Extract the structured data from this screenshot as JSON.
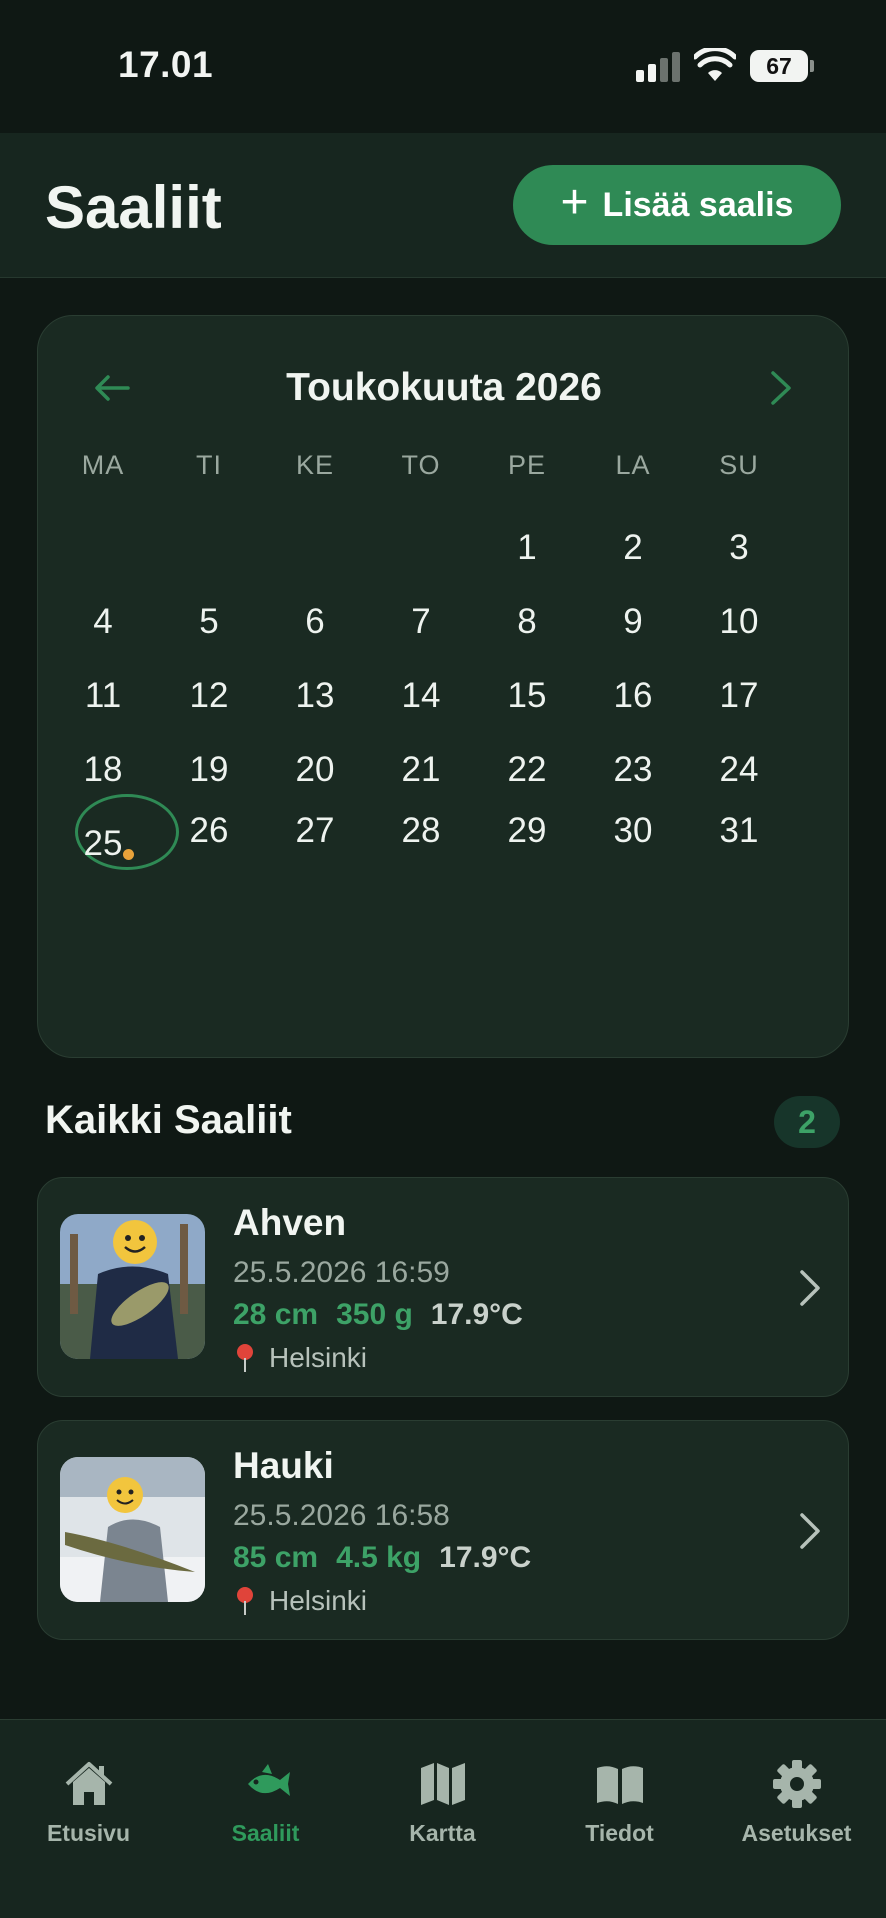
{
  "status": {
    "time": "17.01",
    "battery": "67"
  },
  "header": {
    "title": "Saaliit",
    "add_button": "Lisää saalis"
  },
  "calendar": {
    "title": "Toukokuuta 2026",
    "weekdays": [
      "MA",
      "TI",
      "KE",
      "TO",
      "PE",
      "LA",
      "SU"
    ],
    "days": [
      "1",
      "2",
      "3",
      "4",
      "5",
      "6",
      "7",
      "8",
      "9",
      "10",
      "11",
      "12",
      "13",
      "14",
      "15",
      "16",
      "17",
      "18",
      "19",
      "20",
      "21",
      "22",
      "23",
      "24",
      "25",
      "26",
      "27",
      "28",
      "29",
      "30",
      "31"
    ],
    "selected_day": "25"
  },
  "list": {
    "title": "Kaikki Saaliit",
    "count": "2",
    "items": [
      {
        "name": "Ahven",
        "datetime": "25.5.2026 16:59",
        "length": "28 cm",
        "weight": "350 g",
        "temp": "17.9°C",
        "location": "Helsinki"
      },
      {
        "name": "Hauki",
        "datetime": "25.5.2026 16:58",
        "length": "85 cm",
        "weight": "4.5 kg",
        "temp": "17.9°C",
        "location": "Helsinki"
      }
    ]
  },
  "tabs": [
    {
      "label": "Etusivu",
      "icon": "home-icon"
    },
    {
      "label": "Saaliit",
      "icon": "fish-icon",
      "active": true
    },
    {
      "label": "Kartta",
      "icon": "map-icon"
    },
    {
      "label": "Tiedot",
      "icon": "book-icon"
    },
    {
      "label": "Asetukset",
      "icon": "gear-icon"
    }
  ],
  "colors": {
    "background": "#0f1814",
    "card": "#1a2a22",
    "accent": "#2f8a55",
    "accent_text": "#3da267",
    "dot": "#e8a23a"
  }
}
